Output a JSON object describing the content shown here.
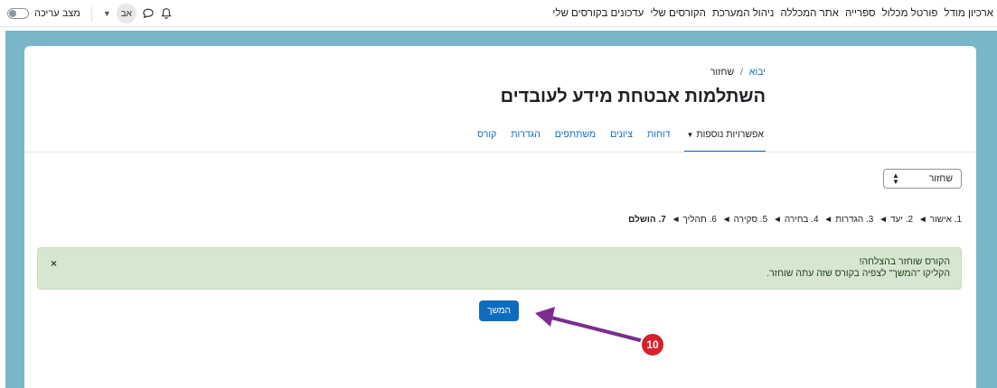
{
  "navbar": {
    "links": [
      "עדכונים בקורסים שלי",
      "הקורסים שלי",
      "ניהול המערכת",
      "אתר המכללה",
      "ספרייה",
      "פורטל מכלול",
      "ארכיון מודל"
    ],
    "edit_mode_label": "מצב עריכה",
    "user_initials": "אב",
    "icons": [
      "bell-icon",
      "chat-icon",
      "chevron-down-icon",
      "toggle-switch"
    ]
  },
  "breadcrumb": {
    "home": "יבוא",
    "separator": "/",
    "current": "שחזור"
  },
  "page_title": "השתלמות אבטחת מידע לעובדים",
  "tabs": [
    "קורס",
    "הגדרות",
    "משתתפים",
    "ציונים",
    "דוחות"
  ],
  "more_tab": "אפשרויות נוספות",
  "select": {
    "value": "שחזור"
  },
  "steps": {
    "items": [
      "1. אישור",
      "2. יעד",
      "3. הגדרות",
      "4. בחירה",
      "5. סקירה",
      "6. תהליך"
    ],
    "current": "7. הושלם",
    "separator": "◄"
  },
  "alert": {
    "line1": "הקורס שוחזר בהצלחה!",
    "line2": "הקליקו \"המשך\" לצפיה בקורס שזה עתה שוחזר.",
    "close": "×"
  },
  "continue_button": "המשך",
  "annotation": {
    "badge": "10",
    "arrow_color": "#7b2d8e",
    "badge_color": "#d6202a"
  },
  "colors": {
    "frame": "#79b6c9",
    "accent": "#0f6cbf",
    "alert_bg": "#d7e6d1"
  }
}
